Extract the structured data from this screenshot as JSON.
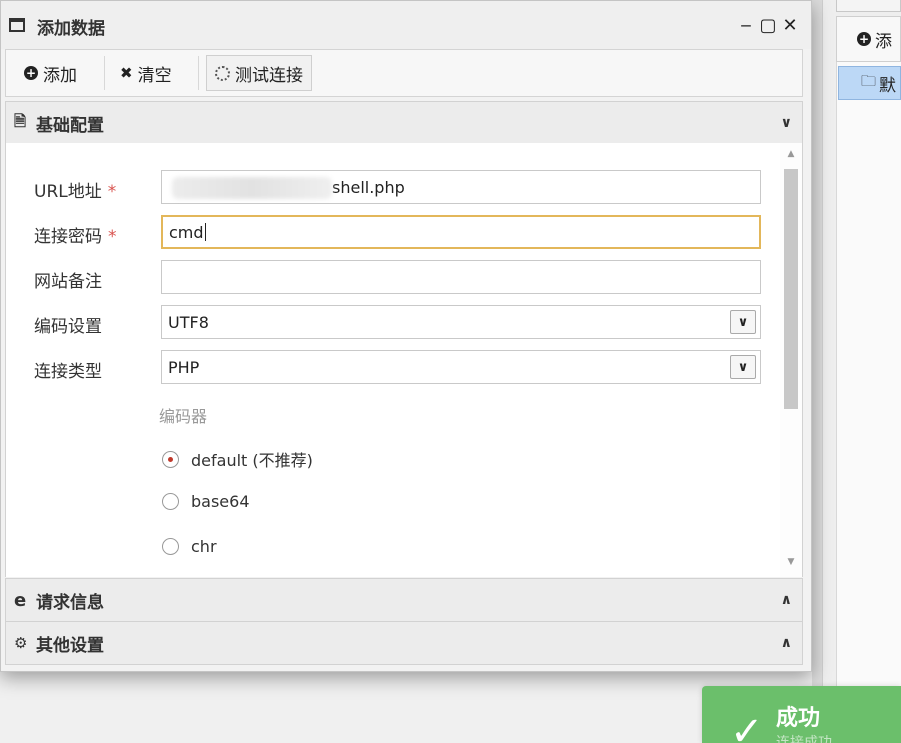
{
  "background_app": {
    "toolbar_add_label": "添",
    "list_item_label": "默"
  },
  "dialog": {
    "title": "添加数据",
    "controls": {
      "minimize": "‒",
      "maximize": "▢",
      "close": "✕"
    },
    "toolbar": {
      "add_label": "添加",
      "clear_label": "清空",
      "test_label": "测试连接"
    },
    "sections": {
      "basic": {
        "title": "基础配置",
        "chevron": "⌄"
      },
      "request": {
        "title": "请求信息",
        "chevron": "⌃"
      },
      "other": {
        "title": "其他设置",
        "chevron": "⌃"
      }
    },
    "form": {
      "url": {
        "label": "URL地址",
        "required_mark": "*",
        "value": "shell.php"
      },
      "password": {
        "label": "连接密码",
        "required_mark": "*",
        "value": "cmd"
      },
      "note": {
        "label": "网站备注",
        "value": ""
      },
      "encoding": {
        "label": "编码设置",
        "value": "UTF8"
      },
      "type": {
        "label": "连接类型",
        "value": "PHP"
      },
      "encoder": {
        "label": "编码器",
        "options": [
          "default (不推荐)",
          "base64",
          "chr"
        ],
        "selected": "default (不推荐)"
      }
    }
  },
  "toast": {
    "title": "成功",
    "message": "连接成功",
    "color": "#6bbf6b"
  }
}
